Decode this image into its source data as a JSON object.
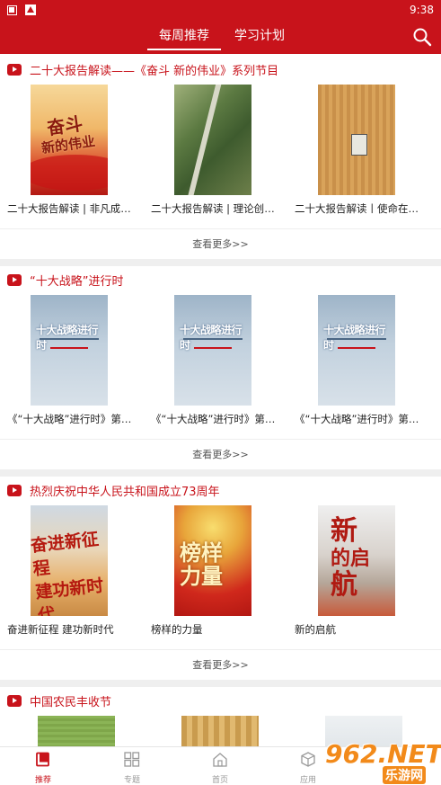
{
  "status_bar": {
    "time": "9:38"
  },
  "header": {
    "tabs": [
      {
        "label": "每周推荐",
        "active": true
      },
      {
        "label": "学习计划",
        "active": false
      }
    ]
  },
  "sections": [
    {
      "title": "二十大报告解读——《奋斗 新的伟业》系列节目",
      "items": [
        {
          "caption": "二十大报告解读 | 非凡成就 ...",
          "poster_text": [
            "奋斗",
            "新的伟业"
          ]
        },
        {
          "caption": "二十大报告解读 | 理论创新 ..."
        },
        {
          "caption": "二十大报告解读丨使命在肩 ..."
        }
      ],
      "more_label": "查看更多>>"
    },
    {
      "title": "“十大战略”进行时",
      "items": [
        {
          "caption": "《“十大战略”进行时》第一集...",
          "poster_text": "十大战略进行时"
        },
        {
          "caption": "《“十大战略”进行时》第二集...",
          "poster_text": "十大战略进行时"
        },
        {
          "caption": "《“十大战略”进行时》第三集...",
          "poster_text": "十大战略进行时"
        }
      ],
      "more_label": "查看更多>>"
    },
    {
      "title": "热烈庆祝中华人民共和国成立73周年",
      "items": [
        {
          "caption": "奋进新征程 建功新时代",
          "poster_text": [
            "奋进新征程",
            "建功新时代"
          ]
        },
        {
          "caption": "榜样的力量",
          "poster_text": [
            "榜样",
            "力量"
          ]
        },
        {
          "caption": "新的启航",
          "poster_text": [
            "新",
            "的启",
            "航"
          ]
        }
      ],
      "more_label": "查看更多>>"
    },
    {
      "title": "中国农民丰收节"
    }
  ],
  "bottom_nav": [
    {
      "label": "推荐",
      "icon": "book-icon",
      "active": true
    },
    {
      "label": "专题",
      "icon": "grid-icon",
      "active": false
    },
    {
      "label": "首页",
      "icon": "home-icon",
      "active": false
    },
    {
      "label": "应用",
      "icon": "cube-icon",
      "active": false
    }
  ],
  "watermark": {
    "number": "962.NET",
    "sub": "乐游网"
  },
  "colors": {
    "brand_red": "#c8131b",
    "watermark_orange": "#f28a1a"
  }
}
